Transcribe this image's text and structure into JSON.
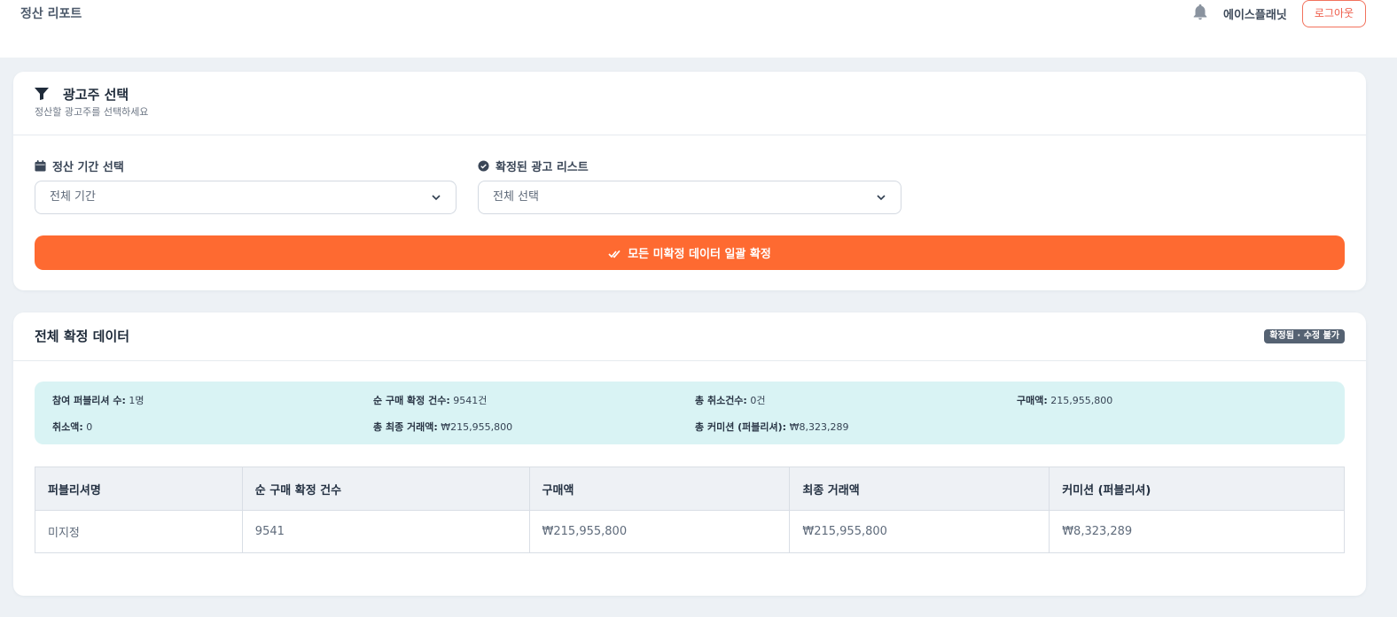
{
  "header": {
    "title": "정산 리포트",
    "company": "에이스플래닛",
    "logout_label": "로그아웃"
  },
  "advertiser_card": {
    "title": "광고주 선택",
    "subtitle": "정산할 광고주를 선택하세요",
    "period_label": "정산 기간 선택",
    "period_value": "전체 기간",
    "ads_label": "확정된 광고 리스트",
    "ads_value": "전체 선택",
    "confirm_all_label": "모든 미확정 데이터 일괄 확정"
  },
  "confirmed_card": {
    "title": "전체 확정 데이터",
    "badge": "확정됨 · 수정 불가",
    "summary": [
      {
        "label": "참여 퍼블리셔 수:",
        "value": "1명"
      },
      {
        "label": "순 구매 확정 건수:",
        "value": "9541건"
      },
      {
        "label": "총 취소건수:",
        "value": "0건"
      },
      {
        "label": "구매액:",
        "value": "215,955,800"
      },
      {
        "label": "취소액:",
        "value": "0"
      },
      {
        "label": "총 최종 거래액:",
        "value": "₩215,955,800"
      },
      {
        "label": "총 커미션 (퍼블리셔):",
        "value": "₩8,323,289"
      }
    ],
    "table": {
      "columns": [
        "퍼블리셔명",
        "순 구매 확정 건수",
        "구매액",
        "최종 거래액",
        "커미션 (퍼블리셔)"
      ],
      "rows": [
        [
          "미지정",
          "9541",
          "₩215,955,800",
          "₩215,955,800",
          "₩8,323,289"
        ]
      ]
    }
  },
  "colors": {
    "accent": "#fe6a31",
    "summary_bg": "#d9f3f4",
    "logout_border": "#f2725d",
    "badge_bg": "#556272"
  }
}
